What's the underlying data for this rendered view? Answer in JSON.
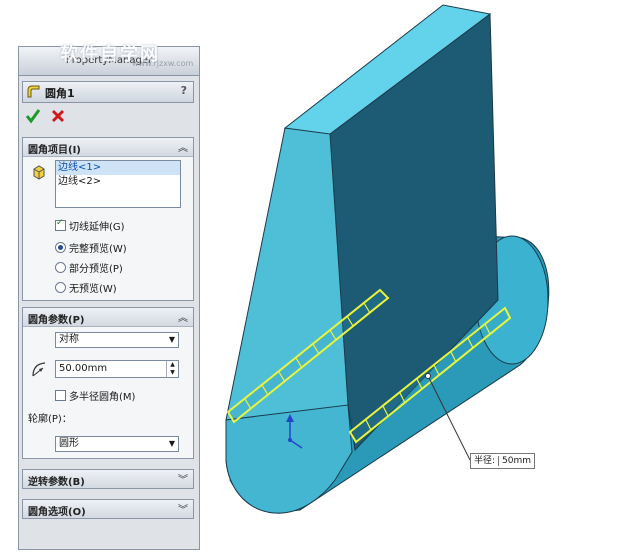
{
  "watermark": {
    "main": "软件自学网",
    "sub": "www.rjzxw.com"
  },
  "property_manager": {
    "tab_label": "PropertyManager",
    "title": "圆角1",
    "help": "?"
  },
  "fillet_items": {
    "header": "圆角项目(I)",
    "edges": [
      "边线<1>",
      "边线<2>"
    ],
    "tangent_propagation": "切线延伸(G)",
    "preview_options": [
      "完整预览(W)",
      "部分预览(P)",
      "无预览(W)"
    ],
    "preview_selected": 0
  },
  "fillet_params": {
    "header": "圆角参数(P)",
    "method": "对称",
    "radius": "50.00mm",
    "multi_radius": "多半径圆角(M)",
    "profile_label": "轮廓(P)：",
    "profile": "圆形"
  },
  "reverse_params": {
    "header": "逆转参数(B)"
  },
  "fillet_options": {
    "header": "圆角选项(O)"
  },
  "callout": {
    "label": "半径:",
    "value": "50mm"
  },
  "colors": {
    "model_light": "#5ec3da",
    "model_mid": "#2b9bb8",
    "model_dark": "#1c4f66",
    "model_top": "#62d4ee",
    "edge_highlight": "#e9f53a"
  }
}
